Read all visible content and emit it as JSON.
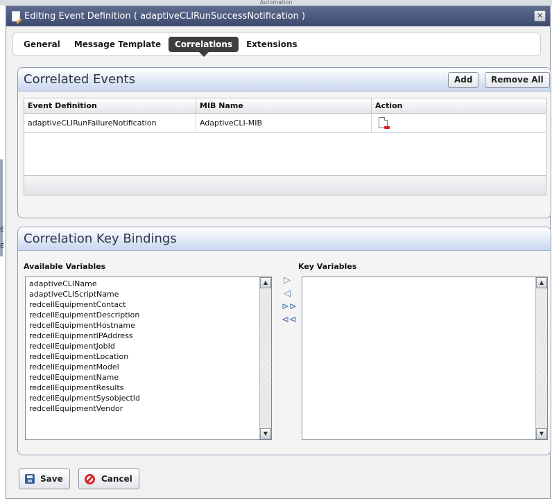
{
  "background": {
    "top_label": "Automation"
  },
  "dialog": {
    "title": "Editing Event Definition ( adaptiveCLIRunSuccessNotification )"
  },
  "tabs": [
    {
      "label": "General"
    },
    {
      "label": "Message Template"
    },
    {
      "label": "Correlations"
    },
    {
      "label": "Extensions"
    }
  ],
  "active_tab": "Correlations",
  "correlated_events": {
    "title": "Correlated Events",
    "add_label": "Add",
    "remove_all_label": "Remove All",
    "columns": [
      "Event Definition",
      "MIB Name",
      "Action"
    ],
    "rows": [
      {
        "event_definition": "adaptiveCLIRunFailureNotification",
        "mib_name": "AdaptiveCLI-MIB",
        "action_icon": "delete-document-icon"
      }
    ]
  },
  "key_bindings": {
    "title": "Correlation Key Bindings",
    "available_label": "Available Variables",
    "key_label": "Key Variables",
    "available_variables": [
      "adaptiveCLIName",
      "adaptiveCLIScriptName",
      "redcellEquipmentContact",
      "redcellEquipmentDescription",
      "redcellEquipmentHostname",
      "redcellEquipmentIPAddress",
      "redcellEquipmentJobId",
      "redcellEquipmentLocation",
      "redcellEquipmentModel",
      "redcellEquipmentName",
      "redcellEquipmentResults",
      "redcellEquipmentSysobjectId",
      "redcellEquipmentVendor"
    ],
    "key_variables": []
  },
  "footer": {
    "save_label": "Save",
    "cancel_label": "Cancel"
  },
  "colors": {
    "titlebar": "#4a5a80",
    "panel_header": "#c8d6f0",
    "active_tab": "#3e3e3e",
    "arrow_blue": "#4c78b4"
  }
}
